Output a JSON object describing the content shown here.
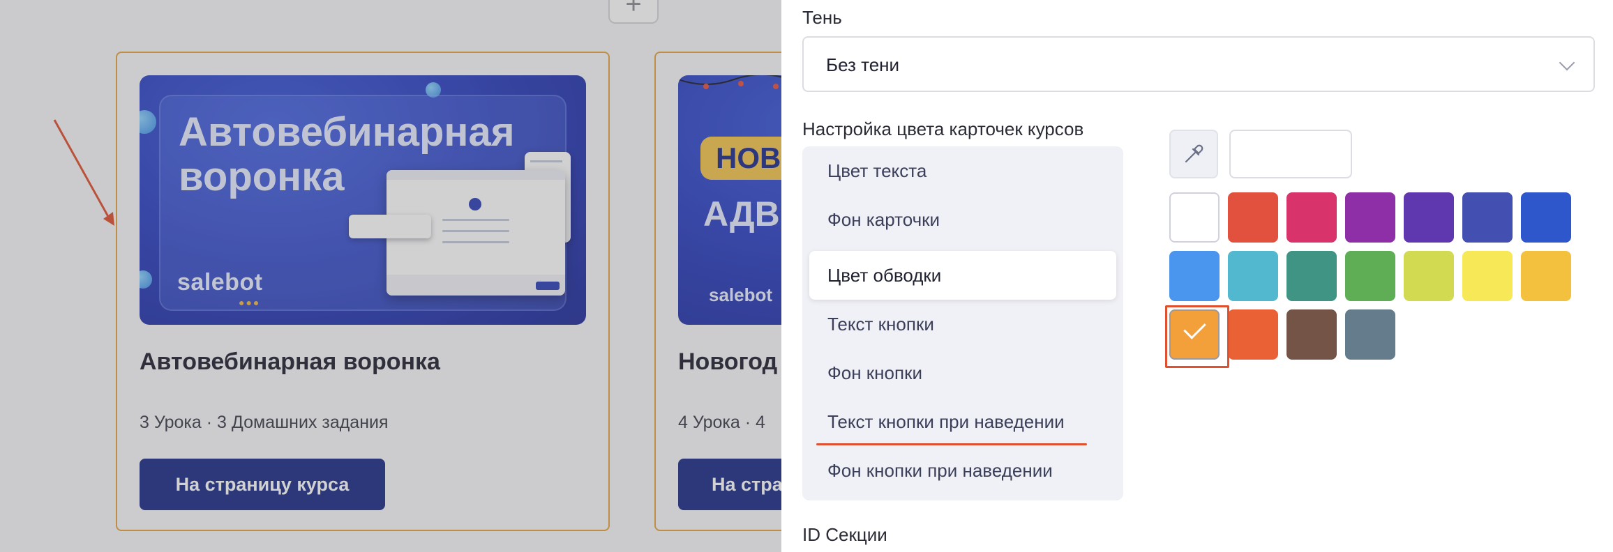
{
  "left_page": {
    "cards": [
      {
        "title": "Автовебинарная воронка",
        "meta": "3 Урока · 3 Домашних задания",
        "button_label": "На страницу курса",
        "cover_title": "Автовебинарная воронка",
        "cover_brand": "salebot"
      },
      {
        "title": "Новогод",
        "meta": "4 Урока · 4",
        "button_label": "На стра",
        "cover_badge": "НОВО",
        "cover_sub": "АДВЕ",
        "cover_brand": "salebot"
      }
    ],
    "add_icon": "plus-icon"
  },
  "panel": {
    "shadow_label": "Тень",
    "shadow_value": "Без тени",
    "card_colors_label": "Настройка цвета карточек курсов",
    "menu_items": [
      "Цвет текста",
      "Фон карточки",
      "Цвет обводки",
      "Текст кнопки",
      "Фон кнопки",
      "Текст кнопки при наведении",
      "Фон кнопки при наведении"
    ],
    "active_menu_index": 2,
    "hex_value": "",
    "section_id_label": "ID Секции",
    "palette": [
      [
        "#ffffff",
        "#e2513d",
        "#d8336a",
        "#8e2fa8",
        "#5f38b0",
        "#4350b2",
        "#2f57cc"
      ],
      [
        "#4a96ee",
        "#52b8d0",
        "#3f9484",
        "#5fae56",
        "#d1da51",
        "#f6e857",
        "#f4c13f"
      ],
      [
        "#f3a03b",
        "#ea6135",
        "#735446",
        "#647c8c"
      ]
    ],
    "selected_color": "#f3a03b"
  }
}
